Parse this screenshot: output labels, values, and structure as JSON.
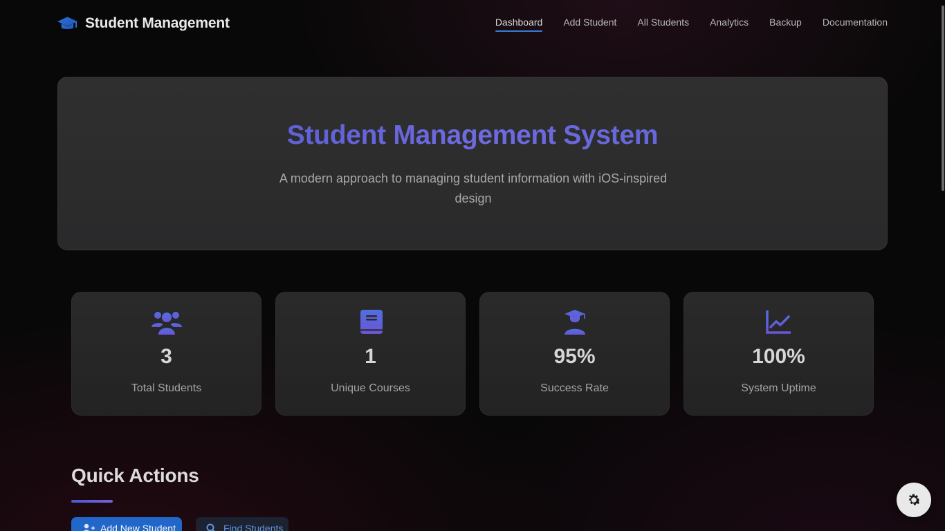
{
  "brand": {
    "title": "Student Management",
    "icon": "graduation-cap-icon"
  },
  "nav": {
    "items": [
      "Dashboard",
      "Add Student",
      "All Students",
      "Analytics",
      "Backup",
      "Documentation"
    ],
    "active": "Dashboard"
  },
  "hero": {
    "title": "Student Management System",
    "subtitle": "A modern approach to managing student information with iOS-inspired design"
  },
  "stats": [
    {
      "icon": "users-icon",
      "value": "3",
      "label": "Total Students"
    },
    {
      "icon": "book-icon",
      "value": "1",
      "label": "Unique Courses"
    },
    {
      "icon": "graduate-icon",
      "value": "95%",
      "label": "Success Rate"
    },
    {
      "icon": "chart-line-icon",
      "value": "100%",
      "label": "System Uptime"
    }
  ],
  "quick_actions": {
    "title": "Quick Actions",
    "buttons": [
      {
        "label": "Add New Student",
        "icon": "user-plus-icon"
      },
      {
        "label": "Find Students",
        "icon": "search-icon"
      }
    ]
  },
  "settings": {
    "icon": "gear-icon"
  },
  "colors": {
    "accent_blue": "#2167c9",
    "hero_title_gradient": "#5b5fd3",
    "icon_purple": "#5a54d6"
  }
}
